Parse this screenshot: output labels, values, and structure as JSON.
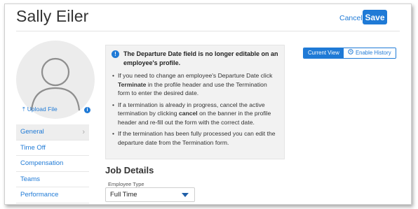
{
  "header": {
    "title": "Sally Eiler",
    "cancel_label": "Cancel",
    "save_label": "Save"
  },
  "profile": {
    "upload_label": "Upload File",
    "info_badge": "i"
  },
  "sidebar": {
    "items": [
      {
        "label": "General",
        "active": true
      },
      {
        "label": "Time Off"
      },
      {
        "label": "Compensation"
      },
      {
        "label": "Teams"
      },
      {
        "label": "Performance"
      }
    ]
  },
  "alert": {
    "icon_glyph": "!",
    "title": "The Departure Date field is no longer editable on an employee's profile.",
    "bullets": [
      {
        "pre": "If you need to change an employee's Departure Date click ",
        "bold": "Terminate",
        "post": " in the profile header and use the Termination form to enter the desired date."
      },
      {
        "pre": "If a termination is already in progress, cancel the active termination by clicking ",
        "bold": "cancel",
        "post": " on the banner in the profile header and re-fill out the form with the correct date."
      },
      {
        "pre": "If the termination has been fully processed you can edit the departure date from the Termination form.",
        "bold": "",
        "post": ""
      }
    ]
  },
  "view_toggle": {
    "current_label": "Current View",
    "history_label": "Enable History"
  },
  "job_details": {
    "section_title": "Job Details",
    "employee_type_label": "Employee Type",
    "employee_type_value": "Full Time"
  },
  "colors": {
    "accent": "#1f7ad6",
    "alert_bg": "#f2f2f2",
    "active_nav_bg": "#eeeeee"
  }
}
